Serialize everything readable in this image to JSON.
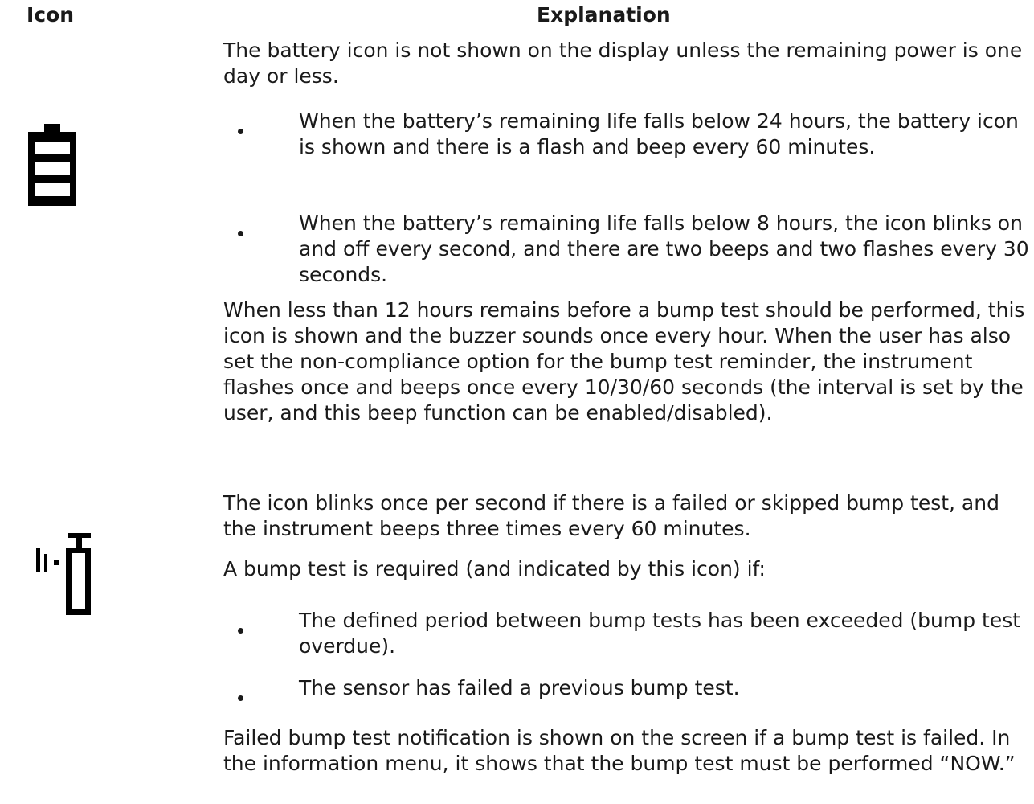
{
  "table": {
    "header_icon": "Icon",
    "header_explanation": "Explanation"
  },
  "battery": {
    "icon": "battery-icon",
    "intro": "The battery icon is not shown on the display unless the remaining power is one day or less.",
    "bullets": [
      "When the battery’s remaining life falls below 24 hours, the battery icon is shown and there is a flash and beep every 60 minutes.",
      "When the battery’s remaining life falls below 8 hours, the icon blinks on and off every second, and there are two beeps and two flashes every 30 seconds."
    ]
  },
  "bump": {
    "icon": "bump-test-icon",
    "reminder": "When less than 12 hours remains before a bump test should be performed, this icon is shown and the buzzer sounds once every hour. When the user has also set the non-compliance option for the bump test reminder, the instrument flashes once and beeps once every 10/30/60 seconds (the interval is set by the user, and this beep function can be enabled/disabled).",
    "blink": "The icon blinks once per second if there is a failed or skipped bump test, and the instrument beeps three times every 60 minutes.",
    "required_intro": "A bump test is required (and indicated by this icon) if:",
    "bullets": [
      "The defined period between bump tests has been exceeded (bump test overdue).",
      "The sensor has failed a previous bump test."
    ],
    "failed": "Failed bump test notification is shown on the screen if a bump test is failed. In the information menu, it shows that the bump test must be performed “NOW.”"
  }
}
